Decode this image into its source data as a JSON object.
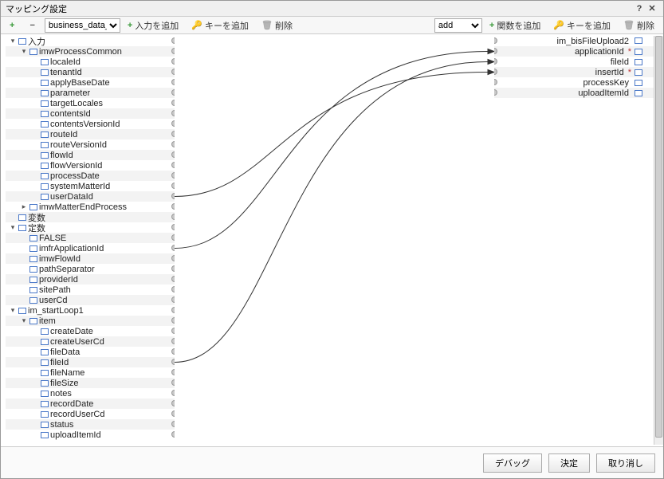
{
  "title": "マッピング設定",
  "toolbar": {
    "expand": "+",
    "collapse": "−",
    "select1": "business_data_st",
    "add_input": "入力を追加",
    "add_key_l": "キーを追加",
    "delete_l": "削除",
    "select2": "add",
    "add_func": "関数を追加",
    "add_key_r": "キーを追加",
    "delete_r": "削除"
  },
  "left_tree": [
    {
      "d": 0,
      "tg": "▾",
      "ti": "obj",
      "lbl": "入力",
      "typ": "<object>"
    },
    {
      "d": 1,
      "tg": "▾",
      "ti": "obj",
      "lbl": "imwProcessCommon",
      "typ": "<object>"
    },
    {
      "d": 2,
      "tg": "",
      "ti": "fld",
      "lbl": "localeId",
      "typ": "<string>"
    },
    {
      "d": 2,
      "tg": "",
      "ti": "fld",
      "lbl": "tenantId",
      "typ": "<string>"
    },
    {
      "d": 2,
      "tg": "",
      "ti": "fld",
      "lbl": "applyBaseDate",
      "typ": "<string>"
    },
    {
      "d": 2,
      "tg": "",
      "ti": "fld",
      "lbl": "parameter",
      "typ": "<string>"
    },
    {
      "d": 2,
      "tg": "",
      "ti": "fld",
      "lbl": "targetLocales",
      "typ": "<string[]>"
    },
    {
      "d": 2,
      "tg": "",
      "ti": "fld",
      "lbl": "contentsId",
      "typ": "<string>"
    },
    {
      "d": 2,
      "tg": "",
      "ti": "fld",
      "lbl": "contentsVersionId",
      "typ": "<string>"
    },
    {
      "d": 2,
      "tg": "",
      "ti": "fld",
      "lbl": "routeId",
      "typ": "<string>"
    },
    {
      "d": 2,
      "tg": "",
      "ti": "fld",
      "lbl": "routeVersionId",
      "typ": "<string>"
    },
    {
      "d": 2,
      "tg": "",
      "ti": "fld",
      "lbl": "flowId",
      "typ": "<string>"
    },
    {
      "d": 2,
      "tg": "",
      "ti": "fld",
      "lbl": "flowVersionId",
      "typ": "<string>"
    },
    {
      "d": 2,
      "tg": "",
      "ti": "fld",
      "lbl": "processDate",
      "typ": "<string>"
    },
    {
      "d": 2,
      "tg": "",
      "ti": "fld",
      "lbl": "systemMatterId",
      "typ": "<string>"
    },
    {
      "d": 2,
      "tg": "",
      "ti": "fld",
      "lbl": "userDataId",
      "typ": "<string>"
    },
    {
      "d": 1,
      "tg": "▸",
      "ti": "obj",
      "lbl": "imwMatterEndProcess",
      "typ": "<object>"
    },
    {
      "d": 0,
      "tg": "",
      "ti": "obj",
      "lbl": "変数",
      "typ": "<object>"
    },
    {
      "d": 0,
      "tg": "▾",
      "ti": "obj",
      "lbl": "定数",
      "typ": "<object>"
    },
    {
      "d": 1,
      "tg": "",
      "ti": "fld",
      "lbl": "FALSE",
      "typ": "<string>"
    },
    {
      "d": 1,
      "tg": "",
      "ti": "fld",
      "lbl": "imfrApplicationId",
      "typ": "<string>"
    },
    {
      "d": 1,
      "tg": "",
      "ti": "fld",
      "lbl": "imwFlowId",
      "typ": "<string>"
    },
    {
      "d": 1,
      "tg": "",
      "ti": "fld",
      "lbl": "pathSeparator",
      "typ": "<string>"
    },
    {
      "d": 1,
      "tg": "",
      "ti": "fld",
      "lbl": "providerId",
      "typ": "<string>"
    },
    {
      "d": 1,
      "tg": "",
      "ti": "fld",
      "lbl": "sitePath",
      "typ": "<string>"
    },
    {
      "d": 1,
      "tg": "",
      "ti": "fld",
      "lbl": "userCd",
      "typ": "<string>"
    },
    {
      "d": 0,
      "tg": "▾",
      "ti": "obj",
      "lbl": "im_startLoop1",
      "typ": "<object>"
    },
    {
      "d": 1,
      "tg": "▾",
      "ti": "obj",
      "lbl": "item",
      "typ": "<object>"
    },
    {
      "d": 2,
      "tg": "",
      "ti": "fld",
      "lbl": "createDate",
      "typ": "<date>"
    },
    {
      "d": 2,
      "tg": "",
      "ti": "fld",
      "lbl": "createUserCd",
      "typ": "<string>"
    },
    {
      "d": 2,
      "tg": "",
      "ti": "fld",
      "lbl": "fileData",
      "typ": "<binary>"
    },
    {
      "d": 2,
      "tg": "",
      "ti": "fld",
      "lbl": "fileId",
      "typ": "<string>"
    },
    {
      "d": 2,
      "tg": "",
      "ti": "fld",
      "lbl": "fileName",
      "typ": "<string>"
    },
    {
      "d": 2,
      "tg": "",
      "ti": "fld",
      "lbl": "fileSize",
      "typ": "<long>"
    },
    {
      "d": 2,
      "tg": "",
      "ti": "fld",
      "lbl": "notes",
      "typ": "<string>"
    },
    {
      "d": 2,
      "tg": "",
      "ti": "fld",
      "lbl": "recordDate",
      "typ": "<date>"
    },
    {
      "d": 2,
      "tg": "",
      "ti": "fld",
      "lbl": "recordUserCd",
      "typ": "<string>"
    },
    {
      "d": 2,
      "tg": "",
      "ti": "fld",
      "lbl": "status",
      "typ": "<string>"
    },
    {
      "d": 2,
      "tg": "",
      "ti": "fld",
      "lbl": "uploadItemId",
      "typ": "<string>"
    }
  ],
  "right_tree": [
    {
      "ti": "obj",
      "lbl": "im_bisFileUpload2",
      "typ": "<object>",
      "req": false
    },
    {
      "ti": "fld",
      "lbl": "applicationId",
      "typ": "<string>",
      "req": true
    },
    {
      "ti": "fld",
      "lbl": "fileId",
      "typ": "<string>",
      "req": false
    },
    {
      "ti": "fld",
      "lbl": "insertId",
      "typ": "<string>",
      "req": true
    },
    {
      "ti": "fld",
      "lbl": "processKey",
      "typ": "<string>",
      "req": false
    },
    {
      "ti": "fld",
      "lbl": "uploadItemId",
      "typ": "<string>",
      "req": false
    }
  ],
  "mappings": [
    {
      "from": 15,
      "to": 3
    },
    {
      "from": 20,
      "to": 1
    },
    {
      "from": 31,
      "to": 2
    }
  ],
  "right_extra_ports": [
    0,
    4,
    5
  ],
  "footer": {
    "debug": "デバッグ",
    "ok": "決定",
    "cancel": "取り消し"
  }
}
